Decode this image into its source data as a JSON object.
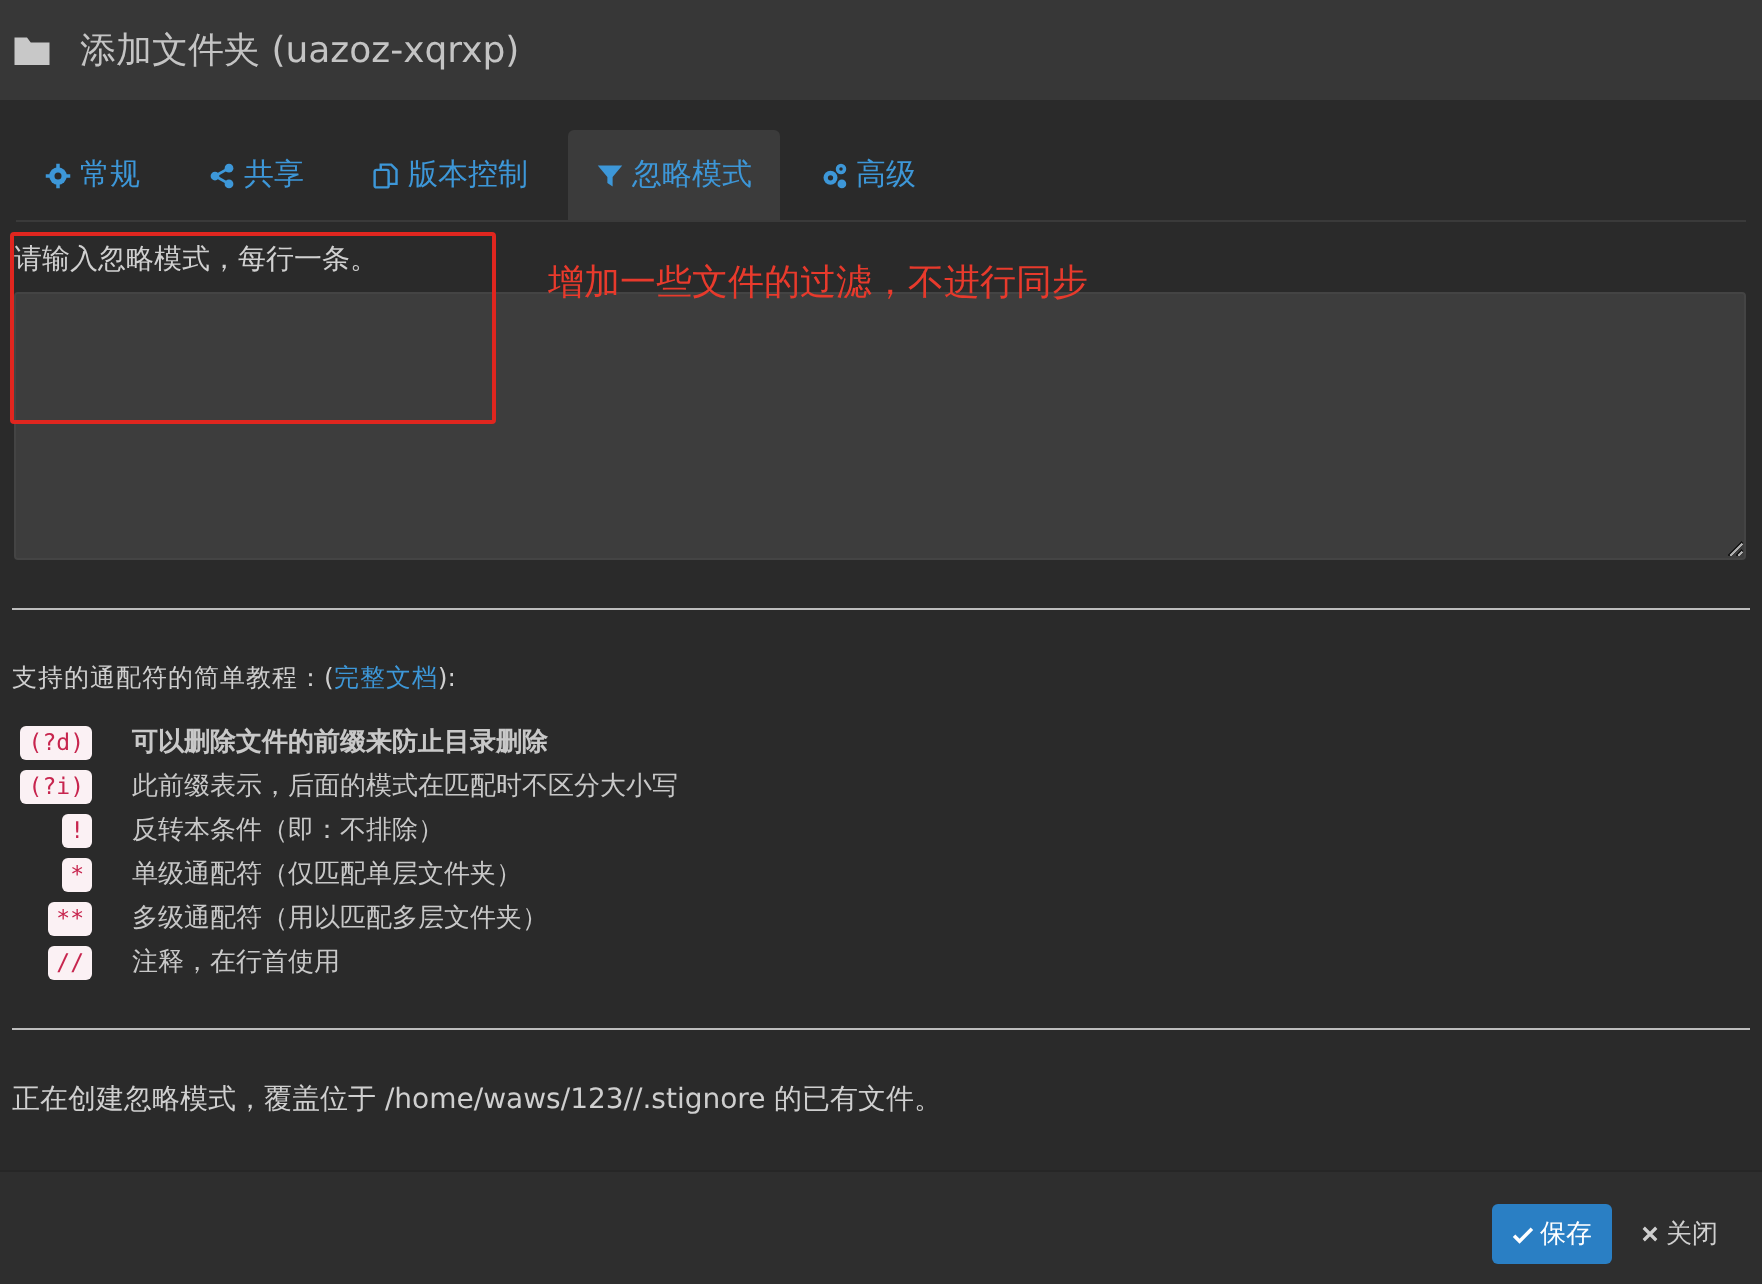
{
  "window": {
    "title": "添加文件夹 (uazoz-xqrxp)"
  },
  "tabs": [
    {
      "label": "常规",
      "kind": "general",
      "selected": false
    },
    {
      "label": "共享",
      "kind": "sharing",
      "selected": false
    },
    {
      "label": "版本控制",
      "kind": "versioning",
      "selected": false
    },
    {
      "label": "忽略模式",
      "kind": "ignore",
      "selected": true
    },
    {
      "label": "高级",
      "kind": "advanced",
      "selected": false
    }
  ],
  "ignore_field": {
    "label": "请输入忽略模式，每行一条。"
  },
  "annotation": {
    "text": "增加一些文件的过滤，不进行同步"
  },
  "tutorial": {
    "before": "支持的通配符的简单教程：(",
    "link": "完整文档",
    "after": "):"
  },
  "patterns": [
    {
      "code": "(?d)",
      "description": "可以删除文件的前缀来防止目录删除",
      "emphasized": true
    },
    {
      "code": "(?i)",
      "description": "此前缀表示，后面的模式在匹配时不区分大小写",
      "emphasized": false
    },
    {
      "code": "!",
      "description": "反转本条件（即：不排除）",
      "emphasized": false
    },
    {
      "code": "*",
      "description": "单级通配符（仅匹配单层文件夹）",
      "emphasized": false
    },
    {
      "code": "**",
      "description": "多级通配符（用以匹配多层文件夹）",
      "emphasized": false
    },
    {
      "code": "//",
      "description": "注释，在行首使用",
      "emphasized": false
    }
  ],
  "notice": "正在创建忽略模式，覆盖位于 /home/waws/123//.stignore 的已有文件。",
  "buttons": [
    {
      "label": "保存",
      "kind": "primary"
    },
    {
      "label": "关闭",
      "kind": "plain"
    }
  ]
}
